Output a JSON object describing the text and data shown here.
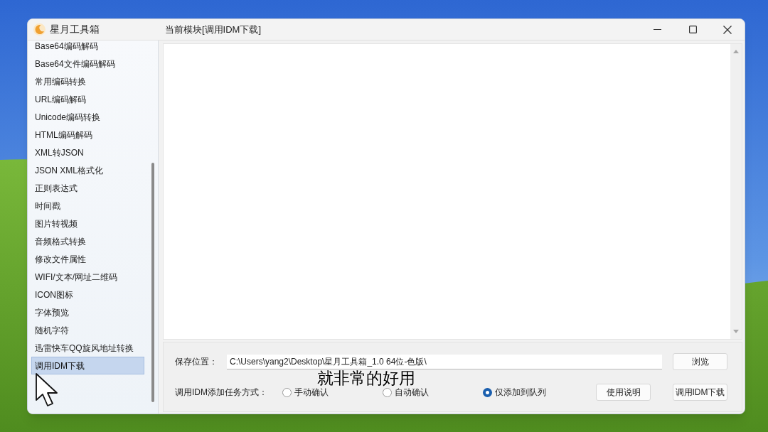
{
  "window": {
    "app_title": "星月工具箱",
    "module_title": "当前模块[调用IDM下载]"
  },
  "sidebar": {
    "items": [
      {
        "label": "Base64编码解码",
        "selected": false
      },
      {
        "label": "Base64文件编码解码",
        "selected": false
      },
      {
        "label": "常用编码转换",
        "selected": false
      },
      {
        "label": "URL编码解码",
        "selected": false
      },
      {
        "label": "Unicode编码转换",
        "selected": false
      },
      {
        "label": "HTML编码解码",
        "selected": false
      },
      {
        "label": "XML转JSON",
        "selected": false
      },
      {
        "label": "JSON XML格式化",
        "selected": false
      },
      {
        "label": "正则表达式",
        "selected": false
      },
      {
        "label": "时间戳",
        "selected": false
      },
      {
        "label": "图片转视频",
        "selected": false
      },
      {
        "label": "音频格式转换",
        "selected": false
      },
      {
        "label": "修改文件属性",
        "selected": false
      },
      {
        "label": "WIFI/文本/网址二维码",
        "selected": false
      },
      {
        "label": "ICON图标",
        "selected": false
      },
      {
        "label": "字体预览",
        "selected": false
      },
      {
        "label": "随机字符",
        "selected": false
      },
      {
        "label": "迅雷快车QQ旋风地址转换",
        "selected": false
      },
      {
        "label": "调用IDM下载",
        "selected": true
      }
    ]
  },
  "form": {
    "save_location": {
      "label": "保存位置：",
      "value": "C:\\Users\\yang2\\Desktop\\星月工具箱_1.0 64位-色版\\"
    },
    "browse_button": "浏览",
    "task_mode": {
      "label": "调用IDM添加任务方式：",
      "options": [
        {
          "label": "手动确认",
          "selected": false
        },
        {
          "label": "自动确认",
          "selected": false
        },
        {
          "label": "仅添加到队列",
          "selected": true
        }
      ]
    },
    "buttons": [
      "使用说明",
      "调用IDM下载"
    ]
  },
  "caption": "就非常的好用"
}
